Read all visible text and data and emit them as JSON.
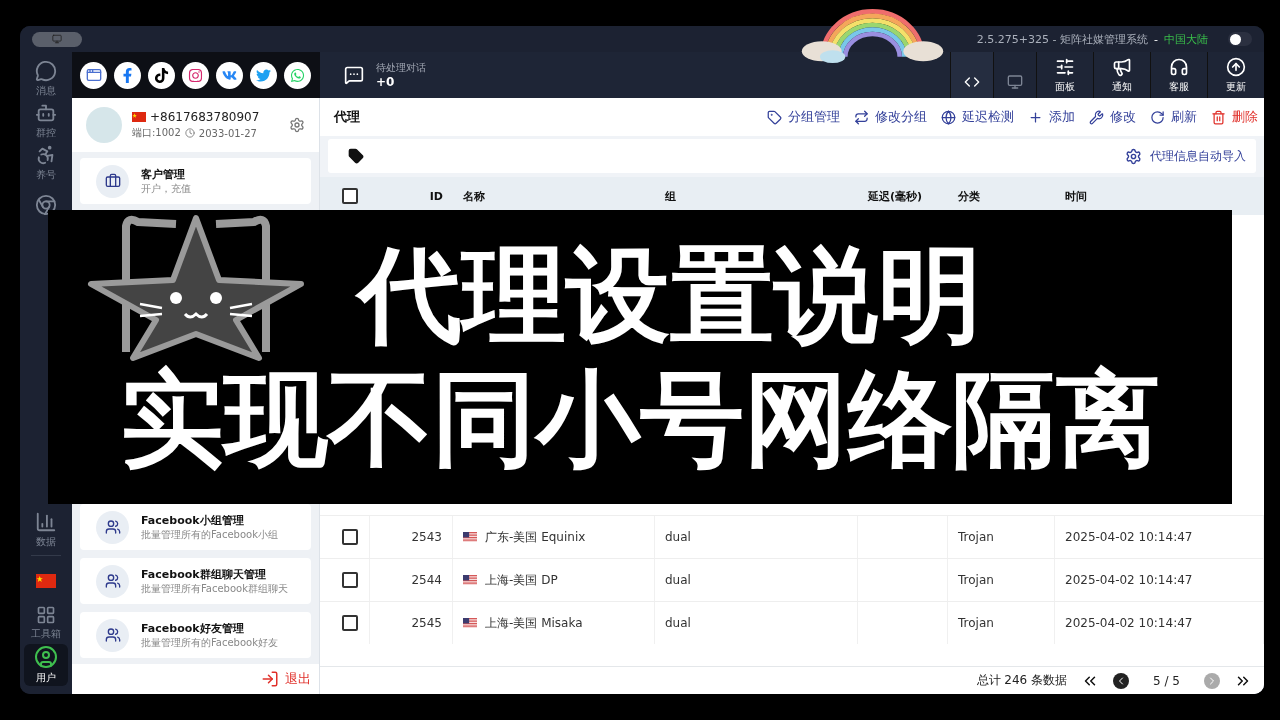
{
  "title_bar": {
    "title": "2.5.275+325 - 矩阵社媒管理系统",
    "separator": "-",
    "region": "中国大陆",
    "switch": {
      "on": false
    }
  },
  "nav": {
    "top": [
      {
        "label": "消息",
        "selected": false
      },
      {
        "label": "群控",
        "selected": false
      },
      {
        "label": "养号",
        "selected": false
      },
      {
        "selected": false
      }
    ],
    "bottom": [
      {
        "label": "数据",
        "selected": false
      },
      {
        "selected": false
      },
      {
        "label": "工具箱",
        "selected": false
      },
      {
        "label": "用户",
        "selected": true
      }
    ]
  },
  "pending": {
    "label": "待处理对话",
    "count": "+0"
  },
  "mode_toggle": [
    {
      "selected": true
    },
    {
      "selected": false
    }
  ],
  "header_buttons": [
    {
      "label": "面板"
    },
    {
      "label": "通知"
    },
    {
      "label": "客服"
    },
    {
      "label": "更新"
    }
  ],
  "account": {
    "phone": "+8617683780907",
    "port": "端口:1002",
    "expiry": "2033-01-27"
  },
  "menu": [
    {
      "title": "客户管理",
      "subtitle": "开户，充值"
    },
    {
      "title": "Facebook小组管理",
      "subtitle": "批量管理所有的Facebook小组"
    },
    {
      "title": "Facebook群组聊天管理",
      "subtitle": "批量管理所有Facebook群组聊天"
    },
    {
      "title": "Facebook好友管理",
      "subtitle": "批量管理所有的Facebook好友"
    }
  ],
  "logout": "退出",
  "page_title": "代理",
  "actions": [
    {
      "label": "分组管理",
      "kind": "normal"
    },
    {
      "label": "修改分组",
      "kind": "normal"
    },
    {
      "label": "延迟检测",
      "kind": "normal"
    },
    {
      "label": "添加",
      "kind": "normal"
    },
    {
      "label": "修改",
      "kind": "normal"
    },
    {
      "label": "刷新",
      "kind": "normal"
    },
    {
      "label": "删除",
      "kind": "danger"
    }
  ],
  "auto_import": "代理信息自动导入",
  "table": {
    "header_checked": false,
    "columns": [
      "ID",
      "名称",
      "组",
      "延迟(毫秒)",
      "分类",
      "时间"
    ],
    "rows": [
      {
        "checked": false,
        "id": "2543",
        "name": "广东-美国 Equinix",
        "group": "dual",
        "type": "Trojan",
        "time": "2025-04-02 10:14:47"
      },
      {
        "checked": false,
        "id": "2544",
        "name": "上海-美国 DP",
        "group": "dual",
        "type": "Trojan",
        "time": "2025-04-02 10:14:47"
      },
      {
        "checked": false,
        "id": "2545",
        "name": "上海-美国 Misaka",
        "group": "dual",
        "type": "Trojan",
        "time": "2025-04-02 10:14:47"
      }
    ]
  },
  "pagination": {
    "summary": "总计 246 条数据",
    "page": "5 / 5",
    "prev": {
      "disabled": false
    },
    "next": {
      "disabled": true
    }
  },
  "banner": {
    "lines": [
      "代理设置说明",
      "实现不同小号网络隔离"
    ]
  }
}
